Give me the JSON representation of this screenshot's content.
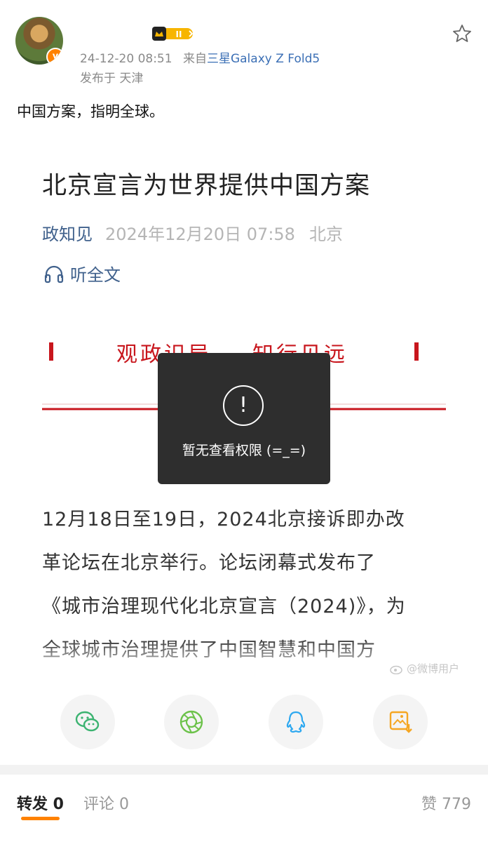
{
  "post": {
    "timestamp": "24-12-20 08:51",
    "source_prefix": "来自",
    "device": "三星Galaxy Z Fold5",
    "location": "发布于 天津",
    "text": "中国方案，指明全球。"
  },
  "article": {
    "title": "北京宣言为世界提供中国方案",
    "author": "政知见",
    "date": "2024年12月20日 07:58",
    "city": "北京",
    "listen_label": "听全文",
    "banner_text": [
      "观政识局",
      "知行见远"
    ],
    "body": [
      "12月18日至19日，2024北京接诉即办改",
      "革论坛在北京举行。论坛闭幕式发布了",
      "《城市治理现代化北京宣言（2024)》，为",
      "全球城市治理提供了中国智慧和中国方"
    ],
    "watermark": "@微博用户"
  },
  "toast": {
    "message": "暂无查看权限 (=_=)"
  },
  "share": [
    "wechat-icon",
    "moments-icon",
    "qq-icon",
    "save-image-icon"
  ],
  "tabs": {
    "repost": "转发 0",
    "comment": "评论 0",
    "likes": "赞 779"
  },
  "colors": {
    "accent": "#ff8200",
    "link": "#3b6fb5",
    "toast_bg": "#2e2e2e"
  }
}
